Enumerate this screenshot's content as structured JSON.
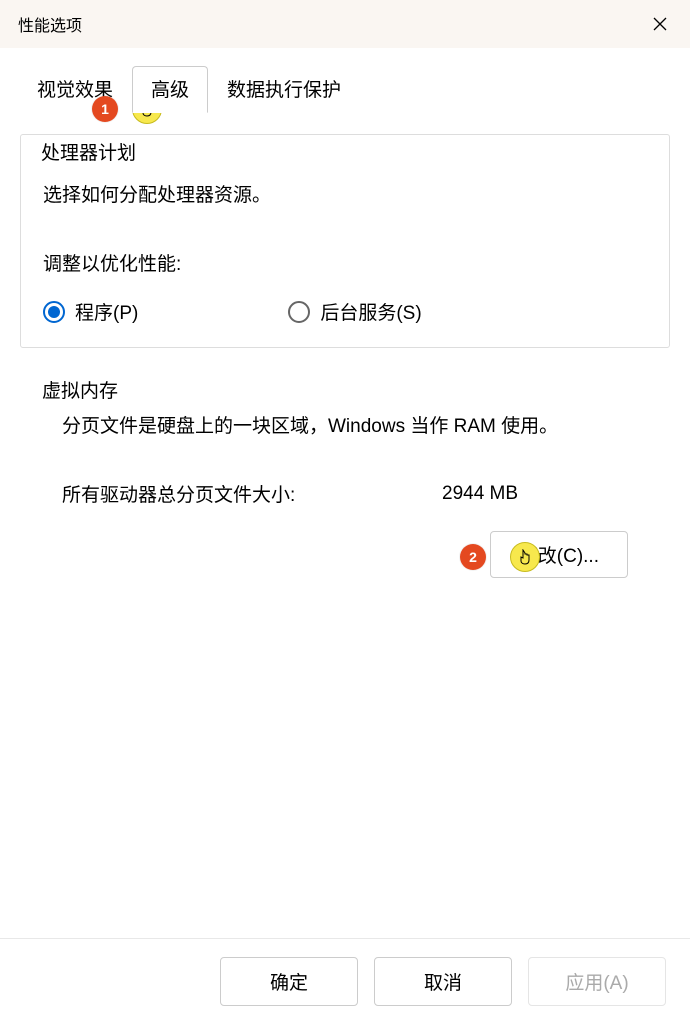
{
  "titlebar": {
    "title": "性能选项"
  },
  "tabs": {
    "visual_effects": "视觉效果",
    "advanced": "高级",
    "dep": "数据执行保护"
  },
  "scheduling": {
    "title": "处理器计划",
    "desc": "选择如何分配处理器资源。",
    "adjust_label": "调整以优化性能:",
    "programs": "程序(P)",
    "background": "后台服务(S)"
  },
  "vm": {
    "title": "虚拟内存",
    "desc": "分页文件是硬盘上的一块区域，Windows 当作 RAM 使用。",
    "total_label": "所有驱动器总分页文件大小:",
    "total_value": "2944 MB",
    "change_button": "更改(C)..."
  },
  "footer": {
    "ok": "确定",
    "cancel": "取消",
    "apply": "应用(A)"
  },
  "callouts": {
    "one": "1",
    "two": "2"
  }
}
